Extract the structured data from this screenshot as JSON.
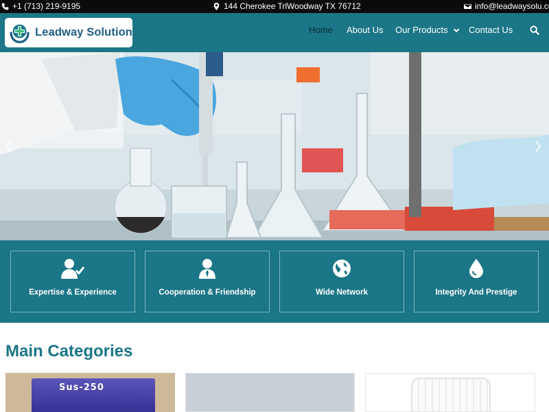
{
  "topbar": {
    "phone": "+1 (713) 219-9195",
    "address": "144 Cherokee TrlWoodway TX 76712",
    "email": "info@leadwaysolu.com"
  },
  "brand": {
    "name": "Leadway Solution",
    "logo_icon": "medical-cross-hands-icon"
  },
  "nav": {
    "items": [
      {
        "label": "Home",
        "active": true
      },
      {
        "label": "About Us"
      },
      {
        "label": "Our Products",
        "has_dropdown": true
      },
      {
        "label": "Contact Us"
      }
    ],
    "search_icon": "search-icon"
  },
  "hero": {
    "prev_icon": "chevron-left-icon",
    "next_icon": "chevron-right-icon"
  },
  "features": [
    {
      "label": "Expertise & Experience",
      "icon": "user-check-icon"
    },
    {
      "label": "Cooperation & Friendship",
      "icon": "user-tie-icon"
    },
    {
      "label": "Wide Network",
      "icon": "globe-icon"
    },
    {
      "label": "Integrity And Prestige",
      "icon": "drop-icon"
    }
  ],
  "categories": {
    "title": "Main Categories",
    "cards": [
      {
        "product_label": "Sus-250"
      },
      {},
      {}
    ]
  },
  "colors": {
    "primary": "#1b7687",
    "topbar": "#0b0b0b",
    "active_nav": "#0e2a33",
    "brand_text": "#1f5f86"
  }
}
